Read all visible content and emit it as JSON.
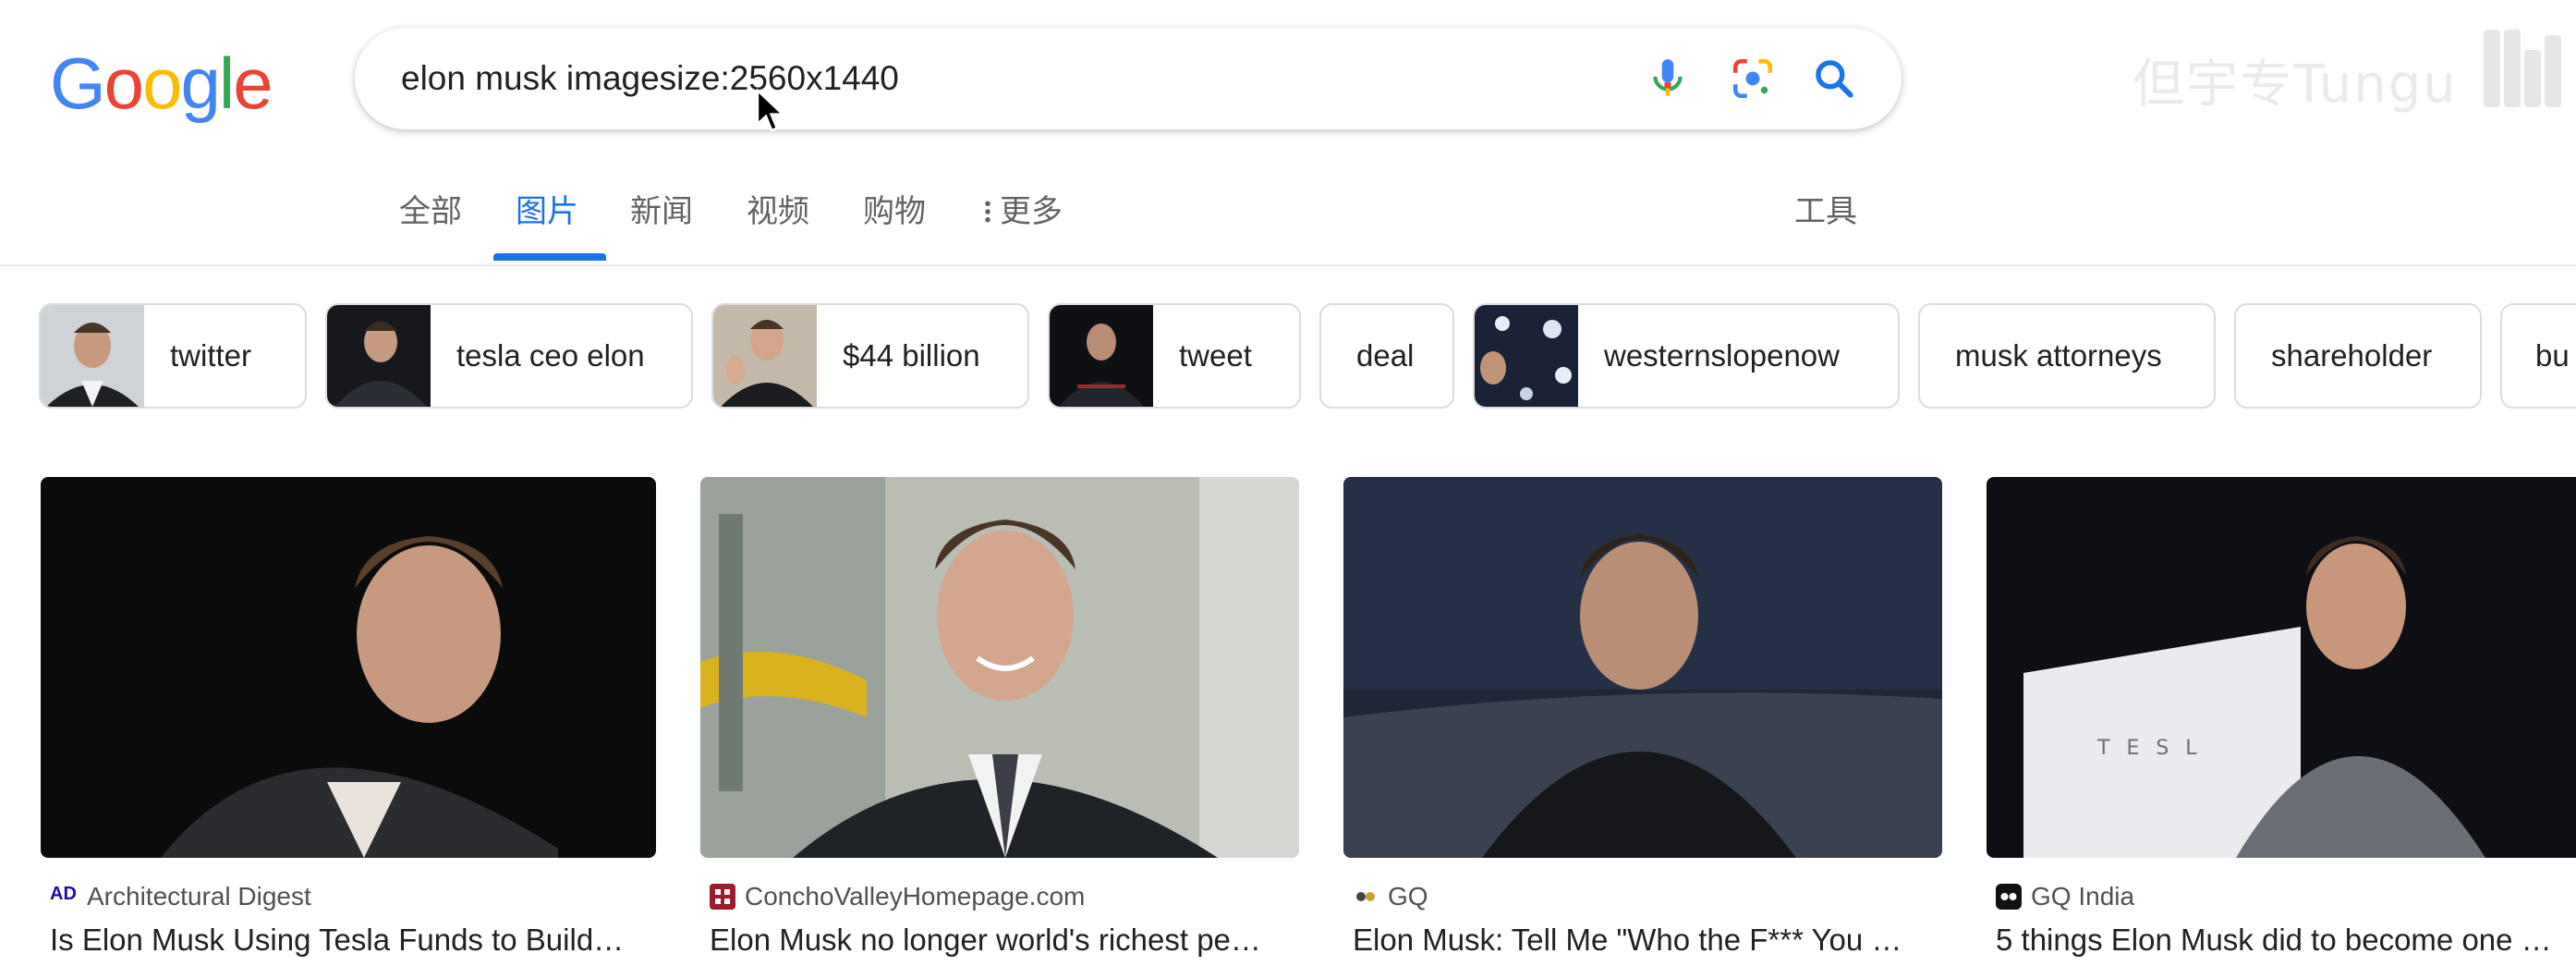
{
  "logo": {
    "letters": [
      "G",
      "o",
      "o",
      "g",
      "l",
      "e"
    ]
  },
  "search": {
    "query": "elon musk imagesize:2560x1440"
  },
  "watermark": {
    "text": "但宇专Tungu"
  },
  "tabs": [
    {
      "label": "全部"
    },
    {
      "label": "图片",
      "active": true
    },
    {
      "label": "新闻"
    },
    {
      "label": "视频"
    },
    {
      "label": "购物"
    },
    {
      "label": "更多"
    }
  ],
  "tools_label": "工具",
  "chips": [
    {
      "label": "twitter"
    },
    {
      "label": "tesla ceo elon"
    },
    {
      "label": "$44 billion"
    },
    {
      "label": "tweet"
    },
    {
      "label": "deal"
    },
    {
      "label": "westernslopenow"
    },
    {
      "label": "musk attorneys"
    },
    {
      "label": "shareholder"
    },
    {
      "label": "bu"
    }
  ],
  "results": [
    {
      "source": "Architectural Digest",
      "fav_text": "AD",
      "title": "Is Elon Musk Using Tesla Funds to Build…"
    },
    {
      "source": "ConchoValleyHomepage.com",
      "fav_text": "",
      "title": "Elon Musk no longer world's richest pe…"
    },
    {
      "source": "GQ",
      "fav_text": "",
      "title": "Elon Musk: Tell Me \"Who the F*** You …"
    },
    {
      "source": "GQ India",
      "fav_text": "",
      "title": "5 things Elon Musk did to become one …"
    }
  ],
  "result_image_text": "TESL",
  "colors": {
    "accent": "#1a73e8",
    "google_blue": "#4285f4",
    "google_red": "#ea4335",
    "google_yellow": "#fbbc05",
    "google_green": "#34a853"
  }
}
